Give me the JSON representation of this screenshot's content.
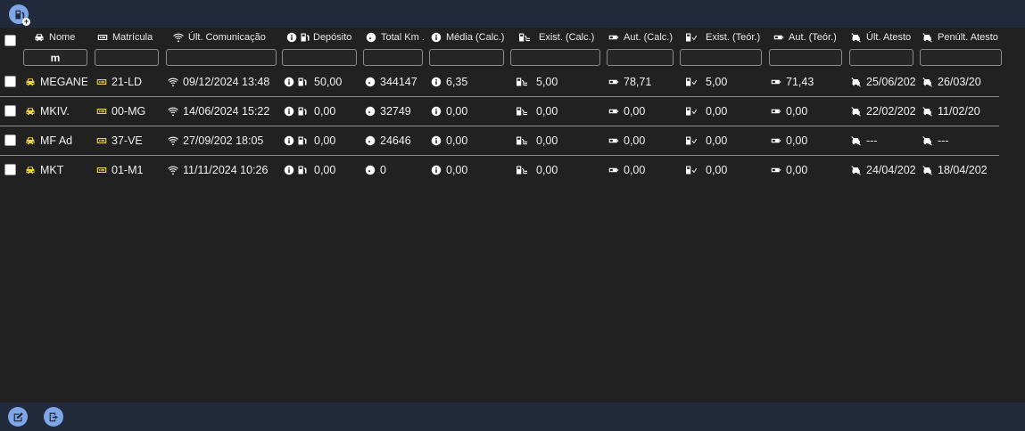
{
  "toolbar": {
    "add_refuel_tooltip": "",
    "colors": {
      "bar": "#212a3b",
      "button": "#7fa6e6",
      "background": "#212121",
      "car_icon": "#f0d44a"
    }
  },
  "columns": {
    "nome": "Nome",
    "matricula": "Matrícula",
    "ult_comunicacao": "Últ. Comunicação",
    "deposito": "Depósito",
    "total_km": "Total Km .",
    "media": "Média (Calc.)",
    "exist_calc": "Exist. (Calc.)",
    "aut_calc": "Aut. (Calc.)",
    "exist_teor": "Exist. (Teór.)",
    "aut_teor": "Aut. (Teór.)",
    "ult_atesto": "Últ. Atesto",
    "penult_atesto": "Penúlt. Atesto"
  },
  "filters": {
    "nome": "m",
    "matricula": "",
    "ult_comunicacao": "",
    "deposito": "",
    "total_km": "",
    "media": "",
    "exist_calc": "",
    "aut_calc": "",
    "exist_teor": "",
    "aut_teor": "",
    "ult_atesto": "",
    "penult_atesto": ""
  },
  "rows": [
    {
      "nome": "MEGANE",
      "matricula": "21-LD",
      "ult_comunicacao": "09/12/2024 13:48",
      "deposito": "50,00",
      "total_km": "344147",
      "media": "6,35",
      "exist_calc": "5,00",
      "aut_calc": "78,71",
      "exist_teor": "5,00",
      "aut_teor": "71,43",
      "ult_atesto": "25/06/202",
      "penult_atesto": "26/03/20"
    },
    {
      "nome": "MKIV.",
      "matricula": "00-MG",
      "ult_comunicacao": "14/06/2024 15:22",
      "deposito": "0,00",
      "total_km": "32749",
      "media": "0,00",
      "exist_calc": "0,00",
      "aut_calc": "0,00",
      "exist_teor": "0,00",
      "aut_teor": "0,00",
      "ult_atesto": "22/02/202",
      "penult_atesto": "11/02/20"
    },
    {
      "nome": "MF Ad",
      "matricula": "37-VE",
      "ult_comunicacao": "27/09/202   18:05",
      "deposito": "0,00",
      "total_km": "24646",
      "media": "0,00",
      "exist_calc": "0,00",
      "aut_calc": "0,00",
      "exist_teor": "0,00",
      "aut_teor": "0,00",
      "ult_atesto": "---",
      "penult_atesto": "---"
    },
    {
      "nome": "MKT",
      "matricula": "01-M1",
      "ult_comunicacao": "11/11/2024 10:26",
      "deposito": "0,00",
      "total_km": "0",
      "media": "0,00",
      "exist_calc": "0,00",
      "aut_calc": "0,00",
      "exist_teor": "0,00",
      "aut_teor": "0,00",
      "ult_atesto": "24/04/202",
      "penult_atesto": "18/04/202"
    }
  ],
  "icons": {
    "nome": "car-icon",
    "matricula": "license-plate-icon",
    "ult_comunicacao": "wifi-icon",
    "deposito": "fuel-pump-icon",
    "total_km": "gauge-icon",
    "media": "info-icon",
    "exist_calc": "fuel-level-icon",
    "aut_calc": "battery-icon",
    "exist_teor": "fuel-check-icon",
    "aut_teor": "battery-icon",
    "ult_atesto": "car-crossed-icon",
    "penult_atesto": "car-crossed-icon"
  },
  "footer": {
    "buttons": [
      "edit-button",
      "export-button"
    ]
  }
}
